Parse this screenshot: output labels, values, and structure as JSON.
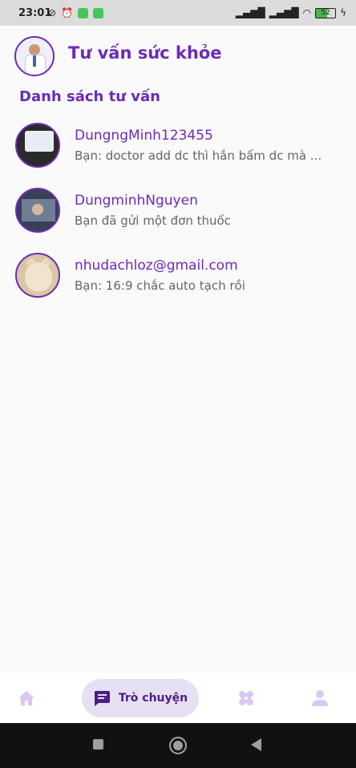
{
  "status_bar": {
    "time": "23:01",
    "battery": "52"
  },
  "header": {
    "title": "Tư vấn sức khỏe"
  },
  "section_title": "Danh sách tư vấn",
  "conversations": [
    {
      "name": "DungngMinh123455",
      "preview": "Bạn: doctor add dc thì hắn bấm dc mà ..."
    },
    {
      "name": "DungminhNguyen",
      "preview": "Bạn đã gửi một đơn thuốc"
    },
    {
      "name": "nhudachloz@gmail.com",
      "preview": "Bạn: 16:9 chắc auto tạch rồi"
    }
  ],
  "bottom_nav": {
    "active_label": "Trò chuyện"
  },
  "colors": {
    "accent": "#6c2bb8",
    "active_nav_bg": "#e7dff2",
    "inactive_icon": "#d9c8f2"
  },
  "icons": [
    "home-icon",
    "chat-icon",
    "bandage-icon",
    "person-icon"
  ]
}
